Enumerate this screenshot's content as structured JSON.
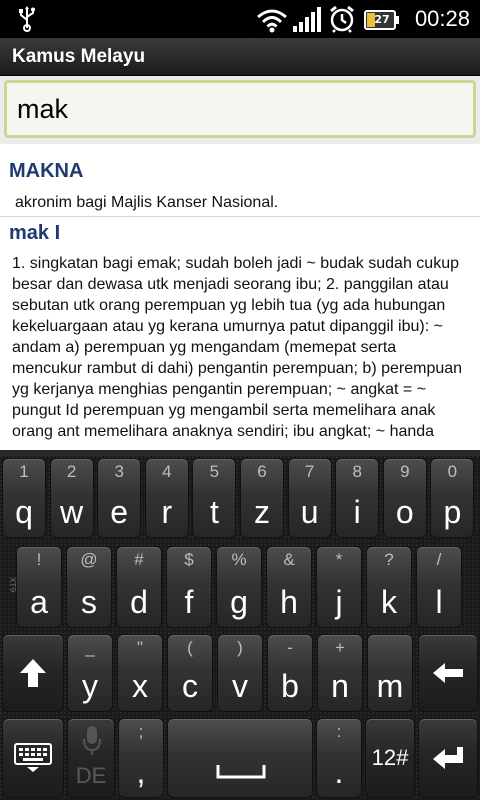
{
  "status": {
    "battery_level": "27",
    "time": "00:28"
  },
  "app": {
    "title": "Kamus Melayu"
  },
  "search": {
    "value": "mak"
  },
  "entries": [
    {
      "heading": "MAKNA",
      "body": "akronim bagi Majlis Kanser Nasional."
    },
    {
      "heading": "mak I",
      "body": "1. singkatan bagi emak; sudah boleh jadi ~ budak sudah cukup besar dan dewasa utk menjadi seorang ibu; 2. panggilan atau sebutan utk orang perempuan yg lebih tua (yg ada hubungan kekeluargaan atau yg kerana umurnya patut dipanggil ibu):     ~ andam a) perempuan yg mengandam (memepat serta mencukur rambut di dahi) pengantin perempuan; b) perempuan yg kerjanya menghias pengantin perempuan; ~ angkat = ~ pungut Id perempuan yg mengambil serta memelihara anak orang ant memelihara anaknya sendiri; ibu angkat; ~ handa"
    }
  ],
  "keyboard": {
    "row1": [
      {
        "hint": "1",
        "key": "q"
      },
      {
        "hint": "2",
        "key": "w"
      },
      {
        "hint": "3",
        "key": "e"
      },
      {
        "hint": "4",
        "key": "r"
      },
      {
        "hint": "5",
        "key": "t"
      },
      {
        "hint": "6",
        "key": "z"
      },
      {
        "hint": "7",
        "key": "u"
      },
      {
        "hint": "8",
        "key": "i"
      },
      {
        "hint": "9",
        "key": "o"
      },
      {
        "hint": "0",
        "key": "p"
      }
    ],
    "row2": [
      {
        "hint": "!",
        "key": "a"
      },
      {
        "hint": "@",
        "key": "s"
      },
      {
        "hint": "#",
        "key": "d"
      },
      {
        "hint": "$",
        "key": "f"
      },
      {
        "hint": "%",
        "key": "g"
      },
      {
        "hint": "&",
        "key": "h"
      },
      {
        "hint": "*",
        "key": "j"
      },
      {
        "hint": "?",
        "key": "k"
      },
      {
        "hint": "/",
        "key": "l"
      }
    ],
    "row3": [
      {
        "hint": "_",
        "key": "y"
      },
      {
        "hint": "\"",
        "key": "x"
      },
      {
        "hint": "(",
        "key": "c"
      },
      {
        "hint": ")",
        "key": "v"
      },
      {
        "hint": "-",
        "key": "b"
      },
      {
        "hint": "+",
        "key": "n"
      },
      {
        "hint": "",
        "key": "m"
      }
    ],
    "row3_hints_fix": [
      "_",
      "\"",
      "(",
      ")",
      "-",
      "+"
    ],
    "semicolon_hint": ";",
    "comma_key": ",",
    "mic_label": "DE",
    "period_hint": ":",
    "period_key": ".",
    "numbers_key": "12#",
    "side_label": "XT9"
  }
}
